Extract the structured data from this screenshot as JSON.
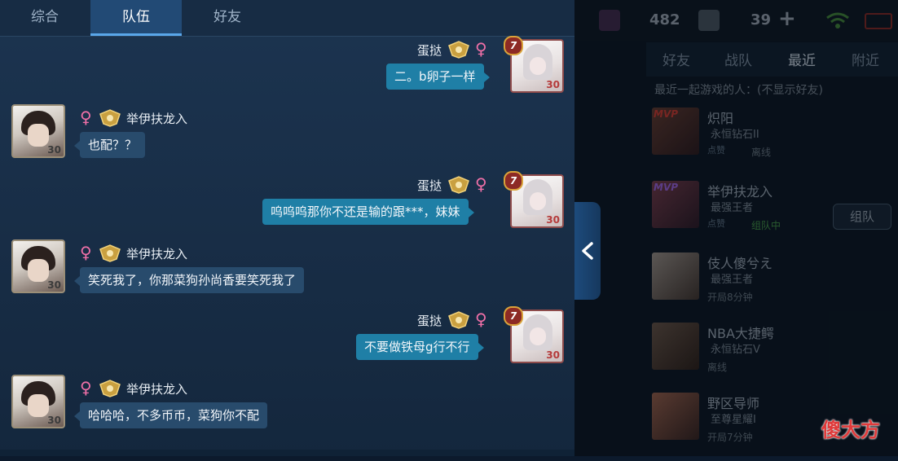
{
  "tabs": [
    {
      "label": "综合"
    },
    {
      "label": "队伍"
    },
    {
      "label": "好友"
    }
  ],
  "messages": [
    {
      "sender": "蛋挞",
      "text": "二。b卵子一样",
      "mine": true,
      "level": "30",
      "badge": "7"
    },
    {
      "sender": "举伊扶龙入",
      "text": "也配？？",
      "mine": false,
      "level": "30"
    },
    {
      "sender": "蛋挞",
      "text": "呜呜呜那你不还是输的跟***，妹妹",
      "mine": true,
      "level": "30",
      "badge": "7"
    },
    {
      "sender": "举伊扶龙入",
      "text": "笑死我了，你那菜狗孙尚香要笑死我了",
      "mine": false,
      "level": "30"
    },
    {
      "sender": "蛋挞",
      "text": "不要做铁母g行不行",
      "mine": true,
      "level": "30",
      "badge": "7"
    },
    {
      "sender": "举伊扶龙入",
      "text": "哈哈哈，不多币币，菜狗你不配",
      "mine": false,
      "level": "30"
    }
  ],
  "gender_symbol": "♀",
  "top_bar": {
    "value1": "482",
    "value2": "39",
    "plus": "+"
  },
  "right_tabs": [
    {
      "label": "好友"
    },
    {
      "label": "战队"
    },
    {
      "label": "最近"
    },
    {
      "label": "附近"
    }
  ],
  "recent_subtitle": "最近一起游戏的人：(不显示好友)",
  "recent": [
    {
      "name": "炽阳",
      "rank": "永恒钻石II",
      "status": "离线",
      "mvp": "MVP",
      "thumb": "点赞"
    },
    {
      "name": "举伊扶龙入",
      "rank": "最强王者",
      "status": "组队中",
      "mvp": "MVP",
      "thumb": "点赞"
    },
    {
      "name": "伎人傻兮え",
      "rank": "最强王者",
      "status": "开局8分钟",
      "mvp": "",
      "thumb": ""
    },
    {
      "name": "NBA大捷鳄",
      "rank": "永恒钻石V",
      "status": "离线",
      "mvp": "",
      "thumb": ""
    },
    {
      "name": "野区导师",
      "rank": "至尊星耀I",
      "status": "开局7分钟",
      "mvp": "",
      "thumb": ""
    }
  ],
  "team_button": "组队",
  "watermark": "傻大方",
  "colors": {
    "mine_bubble": "#1f7fa6",
    "other_bubble": "#284b6c",
    "female": "#f070a8",
    "active_tab": "#224a75"
  }
}
